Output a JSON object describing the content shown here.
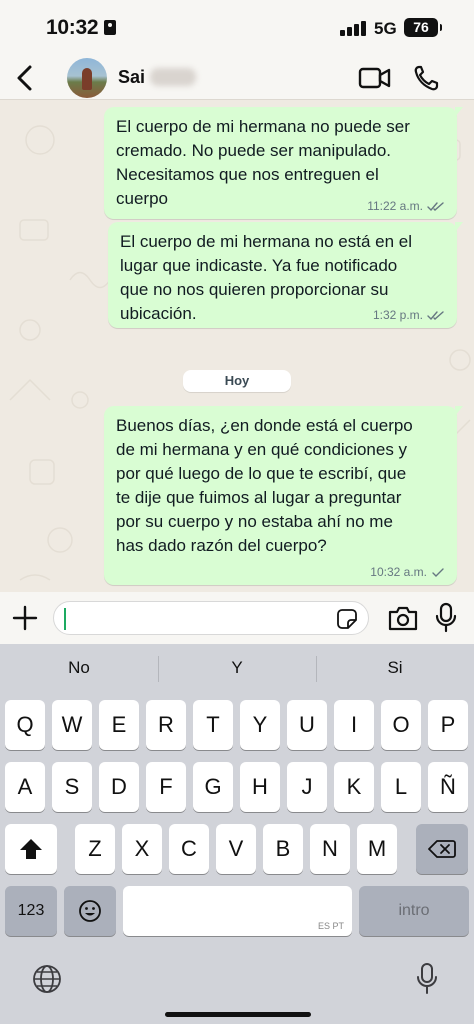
{
  "status_bar": {
    "time": "10:32",
    "network": "5G",
    "battery": "76"
  },
  "header": {
    "contact_name": "Sai"
  },
  "messages": [
    {
      "lines": [
        "El cuerpo de mi hermana no puede ser",
        "cremado. No puede ser manipulado.",
        "Necesitamos que nos entreguen el",
        "cuerpo"
      ],
      "time": "11:22 a.m.",
      "status": "read"
    },
    {
      "lines": [
        "El cuerpo de mi hermana no está en el",
        "lugar que indicaste. Ya fue notificado",
        "que no nos quieren proporcionar su",
        "ubicación."
      ],
      "time": "1:32 p.m.",
      "status": "read"
    },
    {
      "lines": [
        "Buenos días, ¿en donde está el cuerpo",
        "de mi hermana y en qué condiciones y",
        "por qué luego de lo que te escribí, que",
        "te dije que fuimos al lugar a preguntar",
        "por su cuerpo y no estaba ahí no me",
        "has dado razón del cuerpo?"
      ],
      "time": "10:32 a.m.",
      "status": "sent"
    }
  ],
  "date_divider": "Hoy",
  "keyboard": {
    "suggestions": [
      "No",
      "Y",
      "Si"
    ],
    "row1": [
      "Q",
      "W",
      "E",
      "R",
      "T",
      "Y",
      "U",
      "I",
      "O",
      "P"
    ],
    "row2": [
      "A",
      "S",
      "D",
      "F",
      "G",
      "H",
      "J",
      "K",
      "L",
      "Ñ"
    ],
    "row3": [
      "Z",
      "X",
      "C",
      "V",
      "B",
      "N",
      "M"
    ],
    "numbers_key": "123",
    "space_hint": "ES PT",
    "return_key": "intro"
  },
  "colors": {
    "outgoing_bubble": "#d9fdd3",
    "chat_background": "#efeae2",
    "read_tick": "#667781"
  }
}
